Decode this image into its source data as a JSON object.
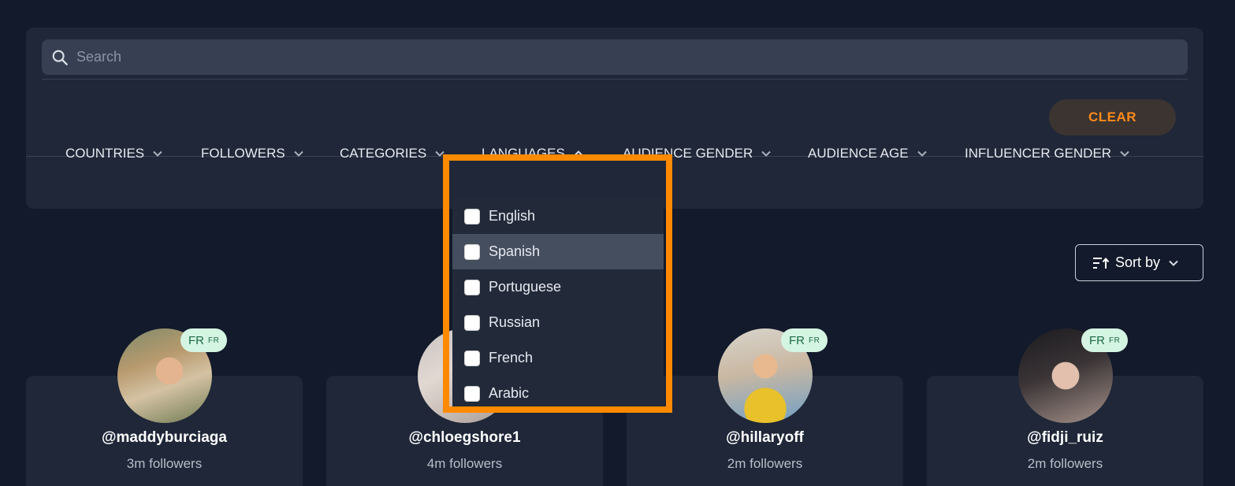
{
  "search": {
    "placeholder": "Search"
  },
  "clear_label": "CLEAR",
  "filters": [
    {
      "label": "COUNTRIES",
      "state": "collapsed"
    },
    {
      "label": "FOLLOWERS",
      "state": "collapsed"
    },
    {
      "label": "CATEGORIES",
      "state": "collapsed"
    },
    {
      "label": "LANGUAGES",
      "state": "expanded"
    },
    {
      "label": "AUDIENCE GENDER",
      "state": "collapsed"
    },
    {
      "label": "AUDIENCE AGE",
      "state": "collapsed"
    },
    {
      "label": "INFLUENCER GENDER",
      "state": "collapsed"
    }
  ],
  "languages_dropdown": {
    "options": [
      {
        "label": "English",
        "checked": false
      },
      {
        "label": "Spanish",
        "checked": false,
        "hovered": true
      },
      {
        "label": "Portuguese",
        "checked": false
      },
      {
        "label": "Russian",
        "checked": false
      },
      {
        "label": "French",
        "checked": false
      },
      {
        "label": "Arabic",
        "checked": false
      }
    ]
  },
  "sort": {
    "label": "Sort by"
  },
  "influencers": [
    {
      "handle": "@maddyburciaga",
      "followers": "3m followers",
      "badge": "FR",
      "badge_small": "FR"
    },
    {
      "handle": "@chloegshore1",
      "followers": "4m followers",
      "badge": "",
      "badge_small": ""
    },
    {
      "handle": "@hillaryoff",
      "followers": "2m followers",
      "badge": "FR",
      "badge_small": "FR"
    },
    {
      "handle": "@fidji_ruiz",
      "followers": "2m followers",
      "badge": "FR",
      "badge_small": "FR"
    }
  ],
  "colors": {
    "background": "#121a2b",
    "panel": "#1f2738",
    "accent_orange": "#ff8a1a",
    "highlight_border": "#ff8a00",
    "badge_bg": "#d5f5e3"
  }
}
